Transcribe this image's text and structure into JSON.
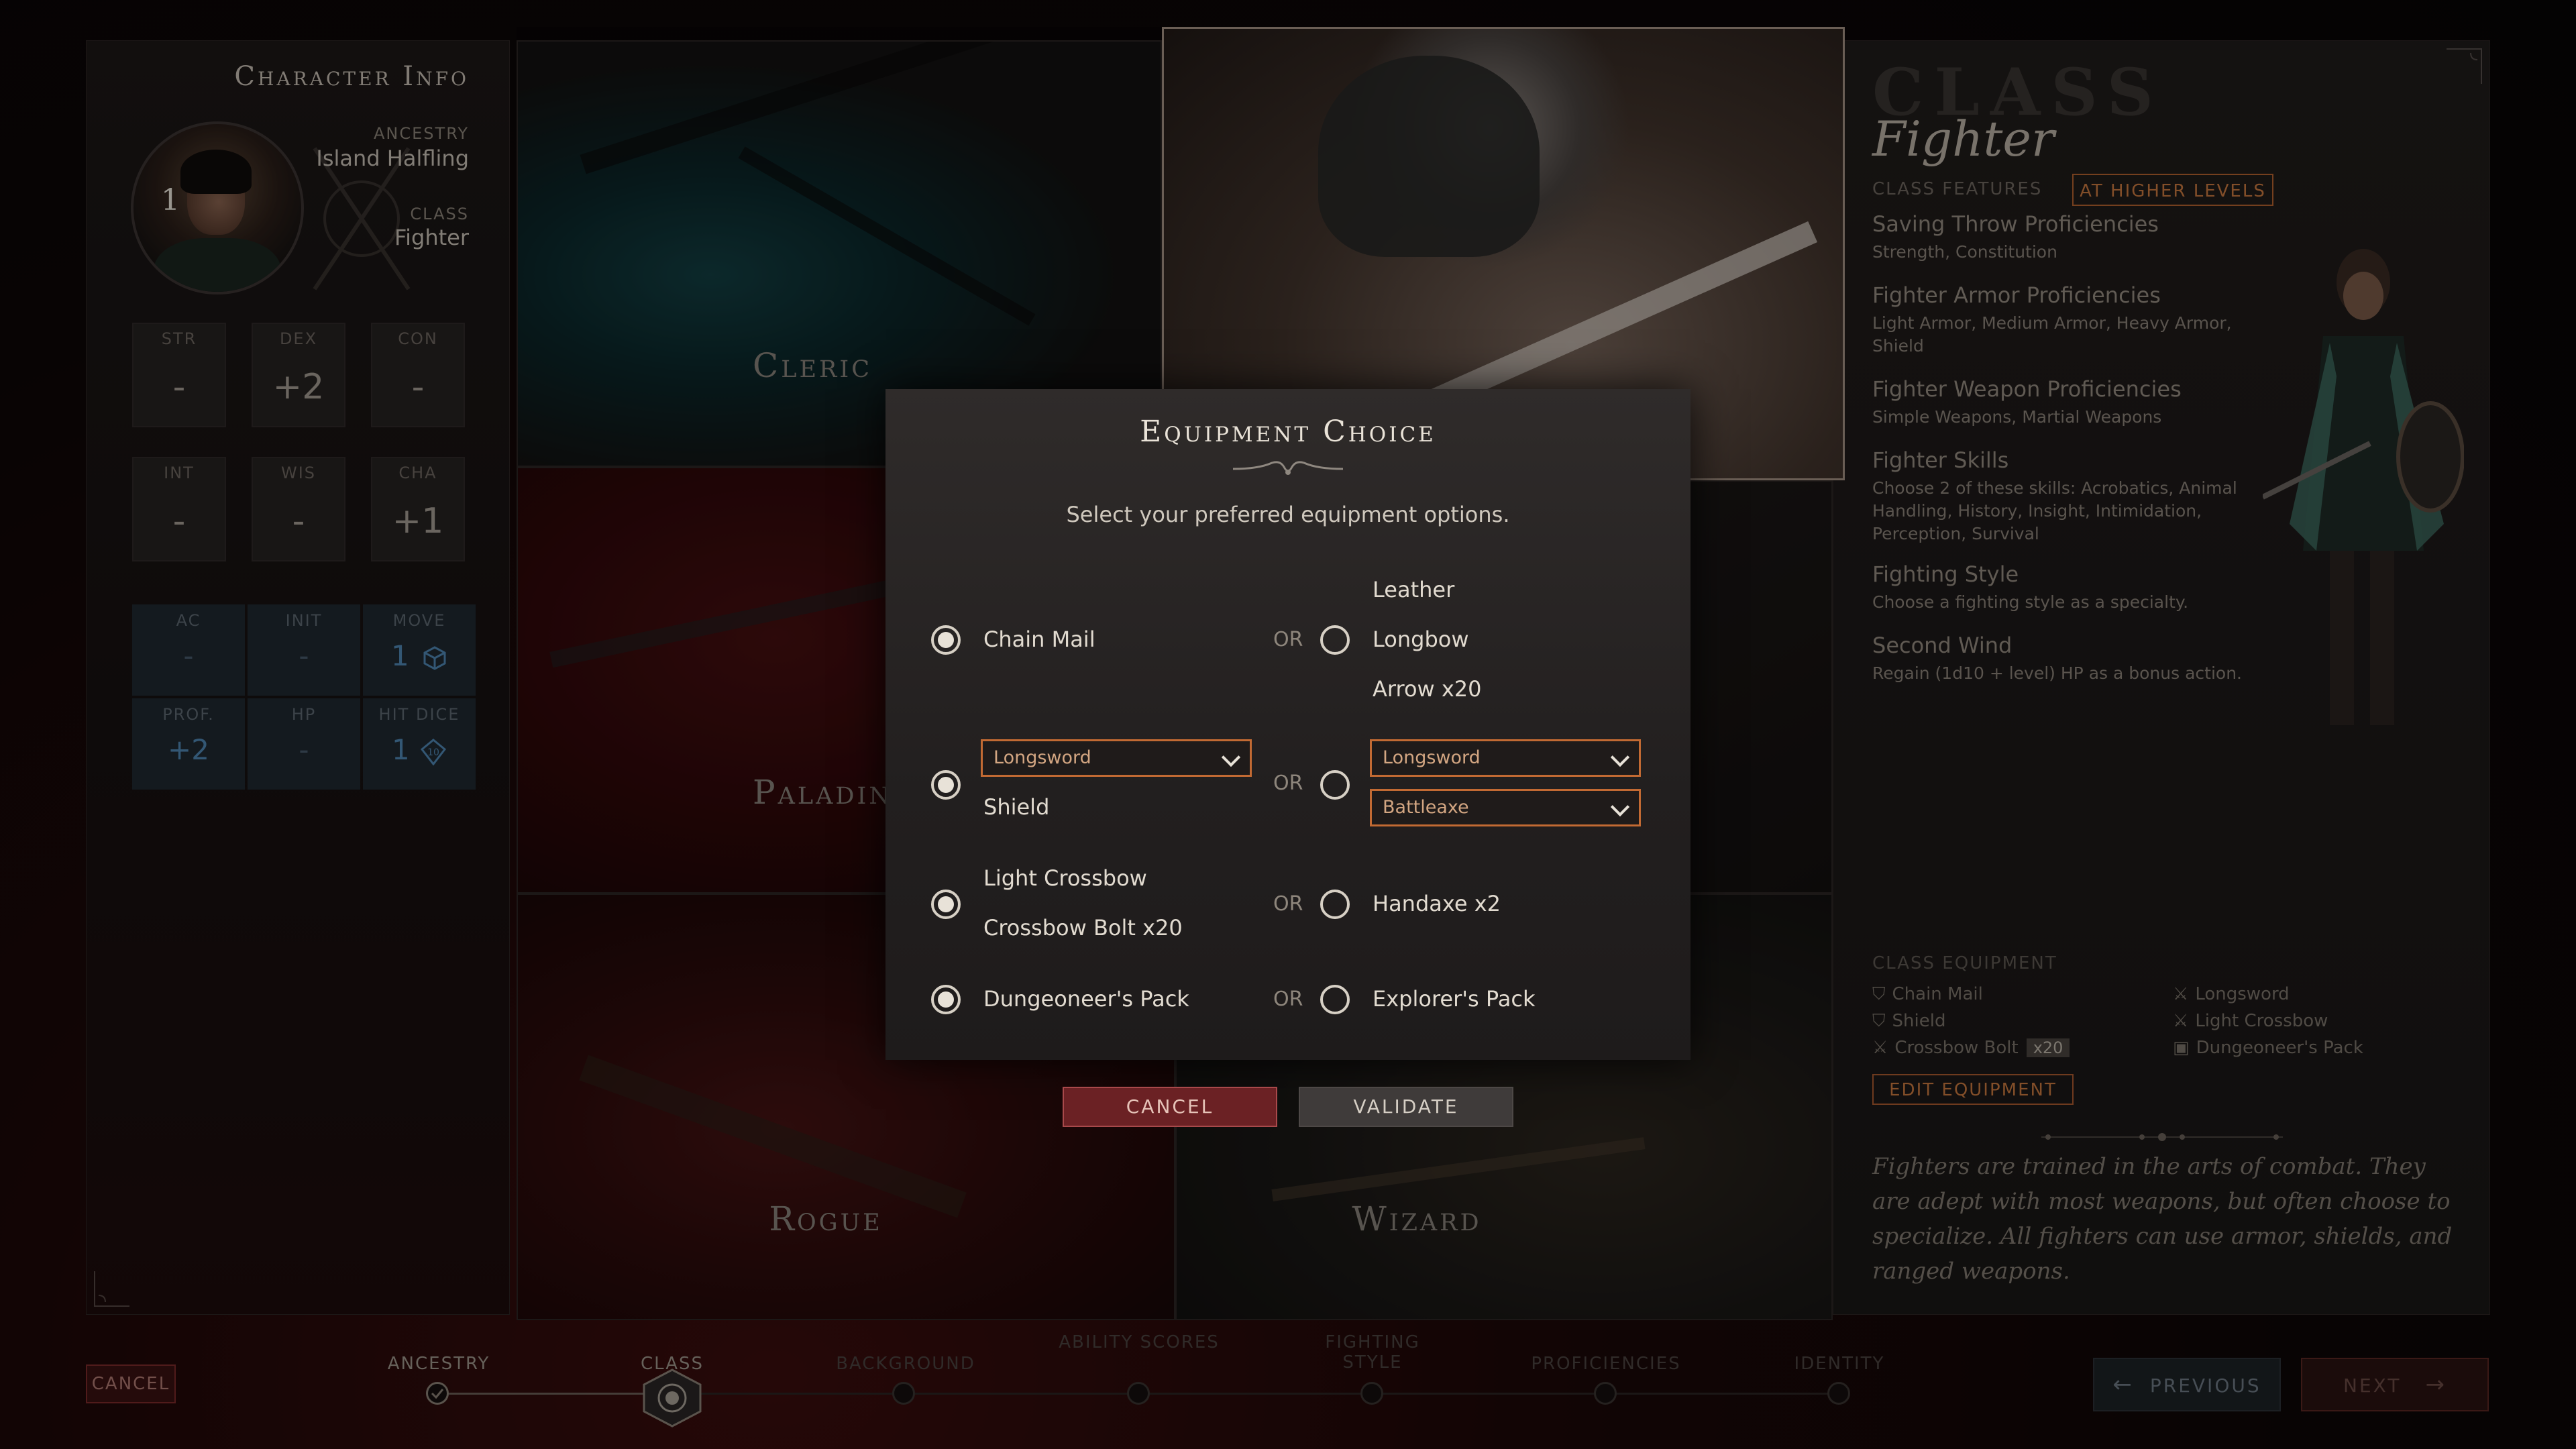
{
  "character": {
    "title": "Character Info",
    "level": "1",
    "ancestry_label": "ANCESTRY",
    "ancestry": "Island Halfling",
    "class_label": "CLASS",
    "class": "Fighter",
    "abilities": [
      {
        "label": "STR",
        "value": "-"
      },
      {
        "label": "DEX",
        "value": "+2"
      },
      {
        "label": "CON",
        "value": "-"
      },
      {
        "label": "INT",
        "value": "-"
      },
      {
        "label": "WIS",
        "value": "-"
      },
      {
        "label": "CHA",
        "value": "+1"
      }
    ],
    "combat": [
      {
        "label": "AC",
        "value": "-"
      },
      {
        "label": "INIT",
        "value": "-"
      },
      {
        "label": "MOVE",
        "value": "1"
      },
      {
        "label": "PROF.",
        "value": "+2"
      },
      {
        "label": "HP",
        "value": "-"
      },
      {
        "label": "HIT DICE",
        "value": "1"
      }
    ]
  },
  "classes": {
    "cleric": "Cleric",
    "fighter": "Fighter",
    "paladin": "Paladin",
    "rogue": "Rogue",
    "wizard": "Wizard"
  },
  "class_panel": {
    "header": "CLASS",
    "name": "Fighter",
    "features_label": "CLASS FEATURES",
    "higher_levels_button": "AT HIGHER LEVELS",
    "features": [
      {
        "title": "Saving Throw Proficiencies",
        "desc": "Strength, Constitution"
      },
      {
        "title": "Fighter Armor Proficiencies",
        "desc": "Light Armor, Medium Armor, Heavy Armor, Shield"
      },
      {
        "title": "Fighter Weapon Proficiencies",
        "desc": "Simple Weapons, Martial Weapons"
      },
      {
        "title": "Fighter Skills",
        "desc": "Choose 2 of these skills: Acrobatics, Animal Handling, History, Insight, Intimidation, Perception, Survival"
      },
      {
        "title": "Fighting Style",
        "desc": "Choose a fighting style as a specialty."
      },
      {
        "title": "Second Wind",
        "desc": "Regain (1d10 + level) HP as a bonus action."
      }
    ],
    "equipment_label": "CLASS EQUIPMENT",
    "equipment": [
      {
        "icon": "shield-icon",
        "name": "Chain Mail"
      },
      {
        "icon": "sword-icon",
        "name": "Longsword"
      },
      {
        "icon": "shield-icon",
        "name": "Shield"
      },
      {
        "icon": "sword-icon",
        "name": "Light Crossbow"
      },
      {
        "icon": "sword-icon",
        "name": "Crossbow Bolt",
        "qty": "x20"
      },
      {
        "icon": "pack-icon",
        "name": "Dungeoneer's Pack"
      }
    ],
    "edit_button": "EDIT EQUIPMENT",
    "description": "Fighters are trained in the arts of combat. They are adept with most weapons, but often choose to specialize. All fighters can use armor, shields, and ranged weapons."
  },
  "modal": {
    "title": "Equipment Choice",
    "subtitle": "Select your preferred equipment options.",
    "or_label": "OR",
    "rows": [
      {
        "left": [
          "Chain Mail"
        ],
        "right": [
          "Leather",
          "Longbow",
          "Arrow x20"
        ],
        "selected": "left"
      },
      {
        "left_dropdown": "Longsword",
        "left": [
          "Shield"
        ],
        "right_dropdowns": [
          "Longsword",
          "Battleaxe"
        ],
        "selected": "left"
      },
      {
        "left": [
          "Light Crossbow",
          "Crossbow Bolt x20"
        ],
        "right": [
          "Handaxe x2"
        ],
        "selected": "left"
      },
      {
        "left": [
          "Dungeoneer's Pack"
        ],
        "right": [
          "Explorer's Pack"
        ],
        "selected": "left"
      }
    ],
    "cancel": "CANCEL",
    "validate": "VALIDATE"
  },
  "footer": {
    "cancel": "CANCEL",
    "steps": [
      {
        "label": "ANCESTRY",
        "state": "done"
      },
      {
        "label": "CLASS",
        "state": "active"
      },
      {
        "label": "BACKGROUND",
        "state": "todo"
      },
      {
        "label": "ABILITY SCORES",
        "state": "todo"
      },
      {
        "label": "FIGHTING STYLE",
        "state": "todo"
      },
      {
        "label": "PROFICIENCIES",
        "state": "todo"
      },
      {
        "label": "IDENTITY",
        "state": "todo"
      }
    ],
    "previous": "PREVIOUS",
    "next": "NEXT"
  },
  "colors": {
    "accent": "#c26a33",
    "cancel": "#6b2124",
    "stat_blue": "#4f86b3"
  }
}
